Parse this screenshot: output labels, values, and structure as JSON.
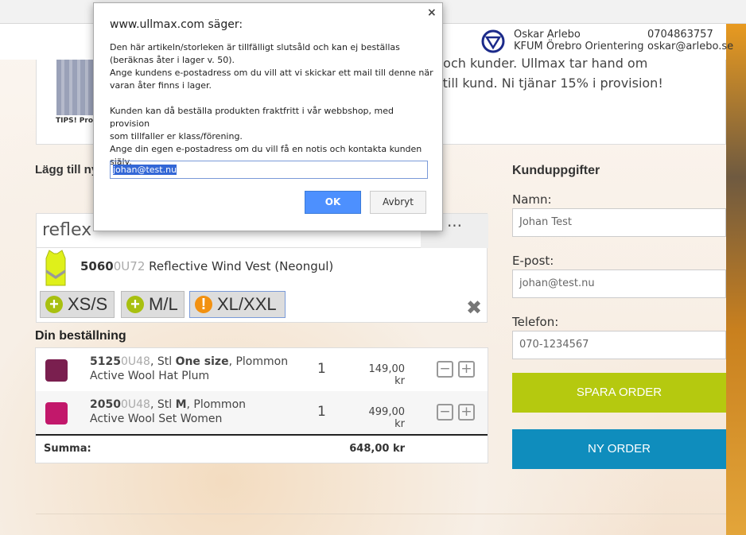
{
  "header": {
    "contact_name": "Oskar Arlebo",
    "club": "KFUM Örebro Orientering",
    "phone": "0704863757",
    "email": "oskar@arlebo.se",
    "logo_icon": "orienteering-triangle-logo"
  },
  "info": {
    "line1": "ta och kunder. Ullmax tar hand om",
    "line2": "kt till kund. Ni tjänar 15% i provision!",
    "tips": "TIPS! Prov"
  },
  "add_section": {
    "heading": "Lägg till ny",
    "search_value": "reflex",
    "more_label": "···",
    "product": {
      "code_bold": "5060",
      "code_grey": "0U72",
      "name": "Reflective Wind Vest (Neongul)"
    },
    "sizes": [
      {
        "label": "XS/S",
        "status": "available",
        "icon": "plus-icon",
        "color": "#a8c010"
      },
      {
        "label": "M/L",
        "status": "available",
        "icon": "plus-icon",
        "color": "#a8c010"
      },
      {
        "label": "XL/XXL",
        "status": "sold-out",
        "icon": "warning-icon",
        "color": "#f29111"
      }
    ],
    "remove_label": "✖"
  },
  "order": {
    "heading": "Din beställning",
    "items": [
      {
        "code_bold": "5125",
        "code_grey": "0U48",
        "stl_prefix": ", Stl ",
        "size": "One size",
        "color": ", Plommon",
        "name": "Active Wool Hat Plum",
        "qty": "1",
        "price": "149,00 kr"
      },
      {
        "code_bold": "2050",
        "code_grey": "0U48",
        "stl_prefix": ", Stl ",
        "size": "M",
        "color": ", Plommon",
        "name": "Active Wool Set Women",
        "qty": "1",
        "price": "499,00 kr"
      }
    ],
    "sum_label": "Summa:",
    "sum_value": "648,00 kr"
  },
  "customer": {
    "heading": "Kunduppgifter",
    "name_label": "Namn:",
    "name_value": "Johan Test",
    "email_label": "E-post:",
    "email_value": "johan@test.nu",
    "phone_label": "Telefon:",
    "phone_value": "070-1234567",
    "save_label": "SPARA ORDER",
    "new_label": "NY ORDER",
    "save_color": "#b5c90f",
    "new_color": "#0f8dbd"
  },
  "dialog": {
    "title": "www.ullmax.com säger:",
    "close": "×",
    "message": "Den här artikeln/storleken är tillfälligt slutsåld och kan ej beställas\n(beräknas åter i lager v. 50).\nAnge kundens e-postadress om du vill att vi skickar ett mail till denne när\nvaran åter finns i lager.\n\nKunden kan då beställa produkten fraktfritt i vår webbshop, med provision\nsom tillfaller er klass/förening.\nAnge din egen e-postadress om du vill få en notis och kontakta kunden\nsjälv.",
    "input_value": "johan@test.nu",
    "ok_label": "OK",
    "cancel_label": "Avbryt"
  }
}
